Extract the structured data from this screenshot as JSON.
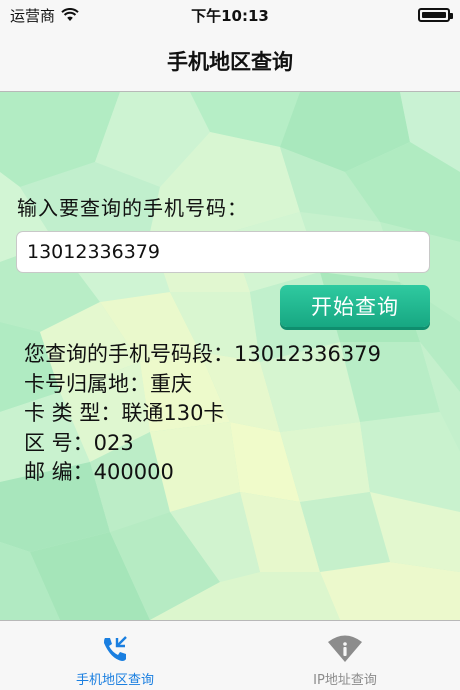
{
  "status_bar": {
    "carrier": "运营商",
    "time": "下午10:13"
  },
  "nav": {
    "title": "手机地区查询"
  },
  "form": {
    "prompt": "输入要查询的手机号码：",
    "phone_value": "13012336379",
    "button_label": "开始查询"
  },
  "results": {
    "lines": [
      "您查询的手机号码段：13012336379",
      "卡号归属地：重庆",
      "卡 类 型：联通130卡",
      "区 号：023",
      "邮 编：400000"
    ]
  },
  "tabs": [
    {
      "label": "手机地区查询",
      "icon": "phone-icon",
      "active": true
    },
    {
      "label": "IP地址查询",
      "icon": "wifi-info-icon",
      "active": false
    }
  ],
  "colors": {
    "accent": "#1a7fe0",
    "button": "#1fb48e"
  }
}
